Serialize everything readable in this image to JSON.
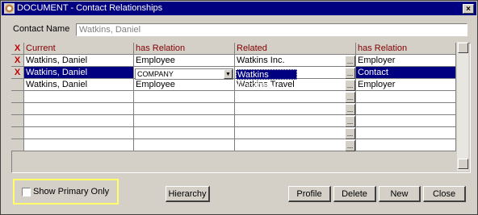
{
  "window": {
    "title": "DOCUMENT - Contact Relationships",
    "close_glyph": "×"
  },
  "contact": {
    "label": "Contact Name",
    "value": "Watkins, Daniel"
  },
  "grid": {
    "x_header": "X",
    "columns": [
      "Current",
      "has Relation",
      "Related",
      "has Relation"
    ],
    "rows": [
      {
        "x": "X",
        "current": "Watkins, Daniel",
        "relation": "Employee",
        "related": "Watkins Inc.",
        "reverse": "Employer",
        "selected": false
      },
      {
        "x": "X",
        "current": "Watkins, Daniel",
        "relation": "COMPANY",
        "related": "Watkins Company",
        "reverse": "Contact",
        "selected": true
      },
      {
        "x": "",
        "current": "Watkins, Daniel",
        "relation": "Employee",
        "related": "Watkins Travel",
        "reverse": "Employer",
        "selected": false
      }
    ],
    "ellipsis": "..."
  },
  "footer": {
    "show_primary_label": "Show Primary Only",
    "show_primary_checked": false,
    "hierarchy_label": "Hierarchy",
    "profile_label": "Profile",
    "delete_label": "Delete",
    "new_label": "New",
    "close_label": "Close"
  },
  "colors": {
    "titlebar": "#000080",
    "header_text": "#800000",
    "x_mark": "#c00000",
    "selection": "#000080",
    "highlight_box": "#ffff66"
  }
}
